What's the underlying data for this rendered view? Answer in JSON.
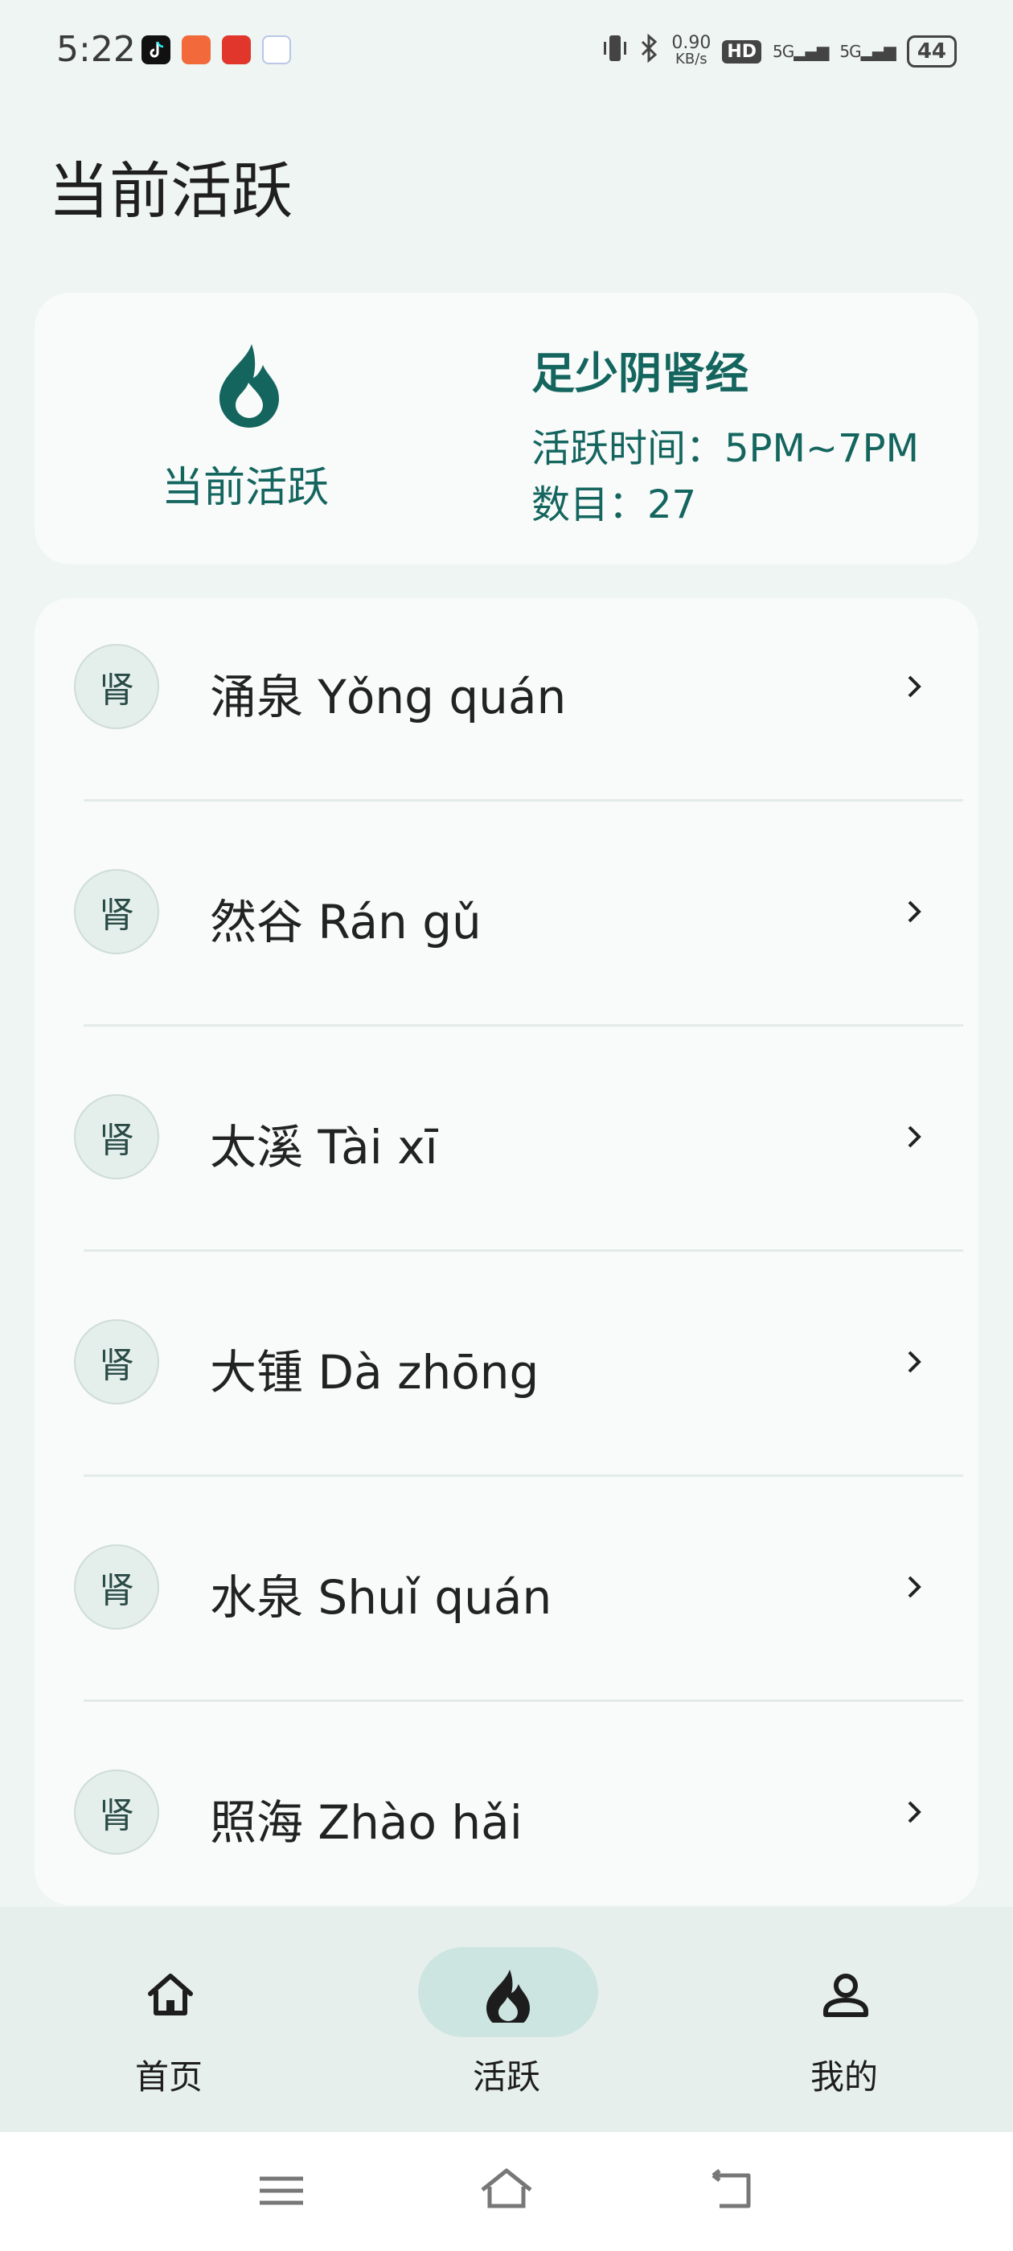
{
  "status_bar": {
    "time": "5:22",
    "net_speed_value": "0.90",
    "net_speed_unit": "KB/s",
    "hd_label": "HD",
    "signal1": "5G",
    "signal2": "5G",
    "battery": "44",
    "icons": [
      "tiktok-icon",
      "app-icon",
      "app-icon",
      "app-icon",
      "vibrate-icon",
      "bluetooth-icon",
      "signal-icon",
      "battery-icon"
    ]
  },
  "page": {
    "title": "当前活跃"
  },
  "active_card": {
    "label": "当前活跃",
    "icon": "flame-icon",
    "meridian": "足少阴肾经",
    "time_text": "活跃时间：5PM~7PM",
    "count_text": "数目：27",
    "accent_color": "#15655f"
  },
  "points": [
    {
      "badge": "肾",
      "name": "涌泉 Yǒng quán"
    },
    {
      "badge": "肾",
      "name": "然谷 Rán gǔ"
    },
    {
      "badge": "肾",
      "name": "太溪 Tài xī"
    },
    {
      "badge": "肾",
      "name": "大锺 Dà zhōng"
    },
    {
      "badge": "肾",
      "name": "水泉 Shuǐ quán"
    },
    {
      "badge": "肾",
      "name": "照海 Zhào hǎi"
    }
  ],
  "bottom_nav": {
    "items": [
      {
        "label": "首页",
        "icon": "home-icon",
        "active": false
      },
      {
        "label": "活跃",
        "icon": "flame-icon",
        "active": true
      },
      {
        "label": "我的",
        "icon": "person-icon",
        "active": false
      }
    ],
    "active_pill_color": "#cde5e0"
  },
  "system_nav": {
    "buttons": [
      "menu-icon",
      "home-outline-icon",
      "back-icon"
    ]
  }
}
